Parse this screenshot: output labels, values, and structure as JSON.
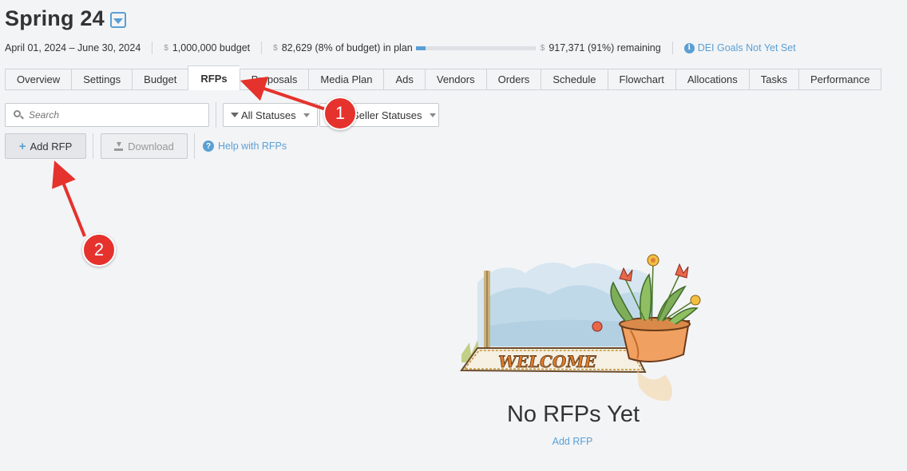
{
  "header": {
    "title": "Spring 24",
    "date_range": "April 01, 2024 – June 30, 2024",
    "currency_symbol": "$",
    "budget_text": "1,000,000 budget",
    "in_plan_text": "82,629 (8% of budget) in plan",
    "in_plan_progress_pct": 8,
    "remaining_text": "917,371 (91%) remaining",
    "dei_link": "DEI Goals Not Yet Set",
    "info_glyph": "i"
  },
  "tabs": [
    {
      "label": "Overview"
    },
    {
      "label": "Settings"
    },
    {
      "label": "Budget"
    },
    {
      "label": "RFPs",
      "active": true
    },
    {
      "label": "Proposals"
    },
    {
      "label": "Media Plan"
    },
    {
      "label": "Ads"
    },
    {
      "label": "Vendors"
    },
    {
      "label": "Orders"
    },
    {
      "label": "Schedule"
    },
    {
      "label": "Flowchart"
    },
    {
      "label": "Allocations"
    },
    {
      "label": "Tasks"
    },
    {
      "label": "Performance"
    }
  ],
  "toolbar": {
    "search_placeholder": "Search",
    "status_filter": "All Statuses",
    "seller_filter": "All Seller Statuses",
    "add_label": "Add RFP",
    "download_label": "Download",
    "help_label": "Help with RFPs",
    "help_glyph": "?"
  },
  "empty_state": {
    "title": "No RFPs Yet",
    "link": "Add RFP",
    "illustration": "welcome-mat-flower-pot"
  },
  "annotations": [
    {
      "label": "1"
    },
    {
      "label": "2"
    }
  ],
  "colors": {
    "accent": "#5a9fd4",
    "annotation": "#e5322d",
    "background": "#f3f4f6"
  }
}
